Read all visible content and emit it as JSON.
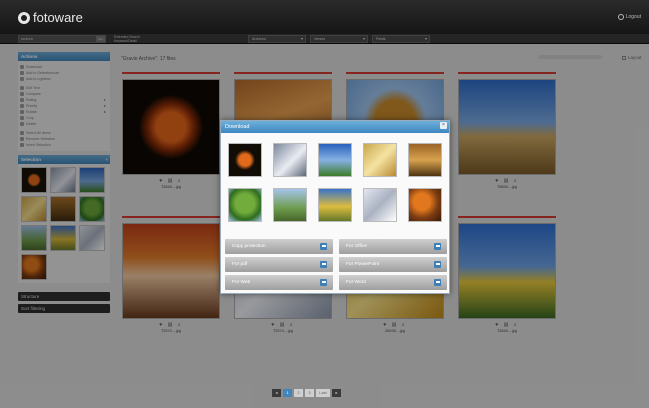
{
  "app": {
    "brand": "fotoware",
    "logout_label": "Logout"
  },
  "search": {
    "placeholder": "search",
    "go_label": "Go",
    "scope_line1": "Extended Search",
    "scope_line2": "Keyword/Detail",
    "dropdowns": [
      "Archives",
      "Verses",
      "Fields"
    ]
  },
  "sidebar": {
    "actions_title": "Actions",
    "actions": [
      {
        "label": "Download"
      },
      {
        "label": "Add to Selection/cart"
      },
      {
        "label": "Add to Lightbox"
      },
      {
        "label": "Edit Text"
      },
      {
        "label": "Compare"
      },
      {
        "label": "Rating",
        "arrow": "▸"
      },
      {
        "label": "Priority",
        "arrow": "▸"
      },
      {
        "label": "Rotate",
        "arrow": "▸"
      },
      {
        "label": "Crop"
      },
      {
        "label": "Delete"
      },
      {
        "label": "Select All Items"
      },
      {
        "label": "Remove Selection"
      },
      {
        "label": "Invert Selection"
      }
    ],
    "selection_title": "Selection",
    "selection_close": "×",
    "structure_label": "Structure",
    "sort_label": "Sort filtering"
  },
  "main": {
    "breadcrumb": "\"Gravie Archive\": 17 files",
    "layout_label": "Layout",
    "cards": [
      {
        "name": "T2845....jpg"
      },
      {
        "name": ""
      },
      {
        "name": ""
      },
      {
        "name": "T5894....jpg"
      },
      {
        "name": "T2570....jpg"
      },
      {
        "name": "T2574....jpg"
      },
      {
        "name": "Z8935....jpg"
      },
      {
        "name": "T2845....jpg"
      }
    ],
    "card_icons": "♥ ▤ ⌕"
  },
  "download_dialog": {
    "title": "Download",
    "close": "×",
    "buttons": [
      {
        "label": "Copy protection"
      },
      {
        "label": "For Office"
      },
      {
        "label": "For pdf"
      },
      {
        "label": "For PowerPoint"
      },
      {
        "label": "For Web"
      },
      {
        "label": "For Word"
      }
    ]
  },
  "pager": {
    "prev": "◂",
    "next": "▸",
    "pages": [
      "1",
      "2",
      "3",
      "Last"
    ],
    "current": "1"
  },
  "colors": {
    "accent_blue": "#3f86bf",
    "card_bar_red": "#d23a33",
    "topbar": "#1c1c1c"
  }
}
